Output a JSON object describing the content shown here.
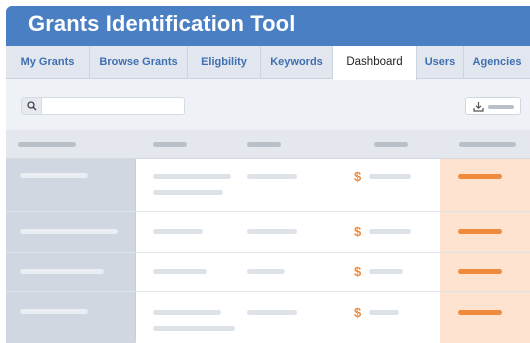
{
  "app": {
    "title": "Grants Identification Tool"
  },
  "tabs": [
    {
      "label": "My Grants",
      "active": false
    },
    {
      "label": "Browse Grants",
      "active": false
    },
    {
      "label": "Eligbility",
      "active": false
    },
    {
      "label": "Keywords",
      "active": false
    },
    {
      "label": "Dashboard",
      "active": true
    },
    {
      "label": "Users",
      "active": false
    },
    {
      "label": "Agencies",
      "active": false
    }
  ],
  "toolbar": {
    "search_value": "",
    "search_icon": "search-icon",
    "export_icon": "download-icon"
  },
  "table": {
    "rows": [
      {
        "currency_symbol": "$"
      },
      {
        "currency_symbol": "$"
      },
      {
        "currency_symbol": "$"
      },
      {
        "currency_symbol": "$"
      }
    ]
  },
  "colors": {
    "header": "#4a7fc3",
    "tab_text": "#3f6fb0",
    "accent": "#f08a3c",
    "highlight_column": "#fde3d0",
    "first_column": "#d0d7e0"
  }
}
